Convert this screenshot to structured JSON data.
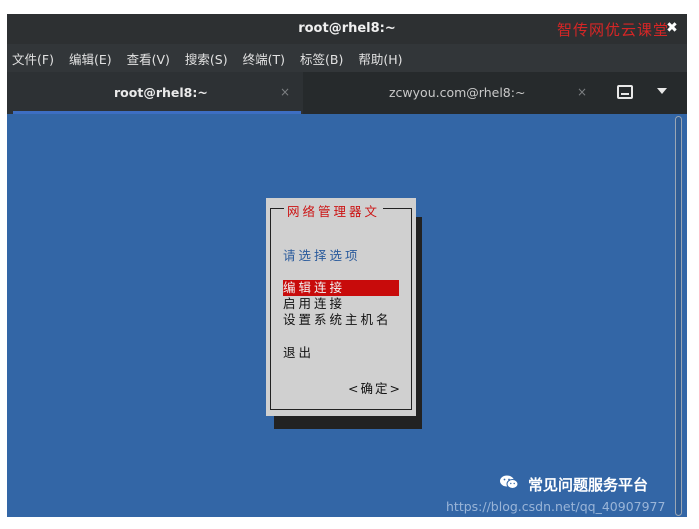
{
  "window": {
    "title": "root@rhel8:~",
    "watermark": "智传网优云课堂",
    "close_symbol": "✖"
  },
  "menu": [
    {
      "label": "文件(F)"
    },
    {
      "label": "编辑(E)"
    },
    {
      "label": "查看(V)"
    },
    {
      "label": "搜索(S)"
    },
    {
      "label": "终端(T)"
    },
    {
      "label": "标签(B)"
    },
    {
      "label": "帮助(H)"
    }
  ],
  "tabs": [
    {
      "label": "root@rhel8:~",
      "close": "×",
      "active": true
    },
    {
      "label": "zcwyou.com@rhel8:~",
      "close": "×",
      "active": false
    }
  ],
  "dialog": {
    "title": "网络管理器文",
    "prompt": "请选择选项",
    "options": [
      "编辑连接",
      "启用连接",
      "设置系统主机名"
    ],
    "selected_index": 0,
    "quit": "退出",
    "ok": "<确定>"
  },
  "overlay": {
    "notice": "常见问题服务平台",
    "url": "https://blog.csdn.net/qq_40907977"
  },
  "colors": {
    "terminal_bg": "#3366a6",
    "dialog_bg": "#d0d0d0",
    "selection": "#c80b0b",
    "dialog_title": "#cc1414",
    "prompt": "#2b5b9c",
    "watermark": "#d62626",
    "tab_underline": "#3d6ec2"
  },
  "icons": {
    "new_tab": "new-tab-icon",
    "tab_menu": "tab-menu-chevron-icon",
    "wechat": "wechat-icon"
  }
}
